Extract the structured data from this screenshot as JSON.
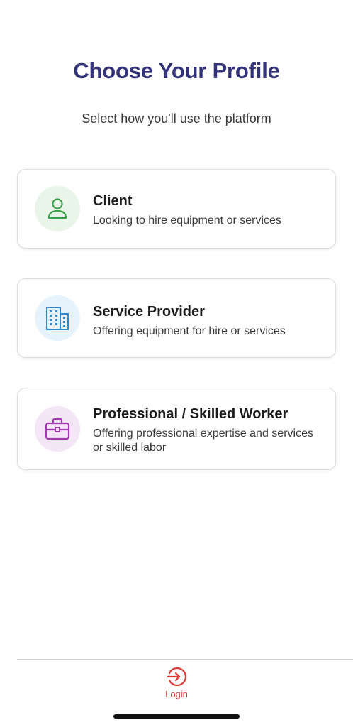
{
  "page": {
    "title": "Choose Your Profile",
    "subtitle": "Select how you'll use the platform"
  },
  "profiles": [
    {
      "title": "Client",
      "description": "Looking to hire equipment or services",
      "icon": "person-icon",
      "color": "#3ca04a"
    },
    {
      "title": "Service Provider",
      "description": "Offering equipment for hire or services",
      "icon": "building-icon",
      "color": "#2a8ad8"
    },
    {
      "title": "Professional / Skilled Worker",
      "description": "Offering professional expertise and services  or skilled labor",
      "icon": "briefcase-icon",
      "color": "#a23bb0"
    }
  ],
  "footer": {
    "login_label": "Login",
    "login_icon": "login-icon",
    "accent": "#d93a34"
  },
  "colors": {
    "title": "#33337a"
  }
}
